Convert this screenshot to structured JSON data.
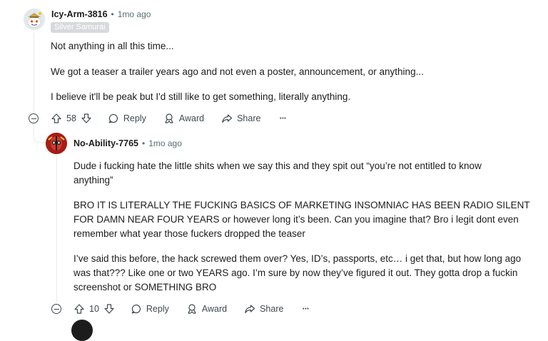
{
  "comments": [
    {
      "username": "Icy-Arm-3816",
      "separator": "•",
      "time": "1mo ago",
      "flair": "Silver Samurai",
      "paragraphs": [
        "Not anything in all this time...",
        "We got a teaser a trailer years ago and not even a poster, announcement, or anything...",
        "I believe it'll be peak but I'd still like to get something, literally anything."
      ],
      "votes": "58",
      "reply_label": "Reply",
      "award_label": "Award",
      "share_label": "Share",
      "more_label": "···"
    },
    {
      "username": "No-Ability-7765",
      "separator": "•",
      "time": "1mo ago",
      "paragraphs": [
        "Dude i fucking hate the little shits when we say this and they spit out “you’re not entitled to know anything”",
        "BRO IT IS LITERALLY THE FUCKING BASICS OF MARKETING INSOMNIAC HAS BEEN RADIO SILENT FOR DAMN NEAR FOUR YEARS or however long it’s been. Can you imagine that? Bro i legit dont even remember what year those fuckers dropped the teaser",
        "I’ve said this before, the hack screwed them over? Yes, ID’s, passports, etc… i get that, but how long ago was that??? Like one or two YEARS ago. I’m sure by now they’ve figured it out. They gotta drop a fuckin screenshot or SOMETHING BRO"
      ],
      "votes": "10",
      "reply_label": "Reply",
      "award_label": "Award",
      "share_label": "Share",
      "more_label": "···"
    }
  ],
  "colors": {
    "text": "#1c1c1c",
    "meta": "#576f76",
    "flair_bg": "#d7dadc",
    "thread_line": "#e5ebee",
    "avatar2_bg": "#b3261e"
  },
  "icons": [
    "snoo-avatar",
    "deadpool-avatar",
    "collapse-icon",
    "upvote-icon",
    "downvote-icon",
    "reply-icon",
    "award-icon",
    "share-icon",
    "more-icon"
  ]
}
